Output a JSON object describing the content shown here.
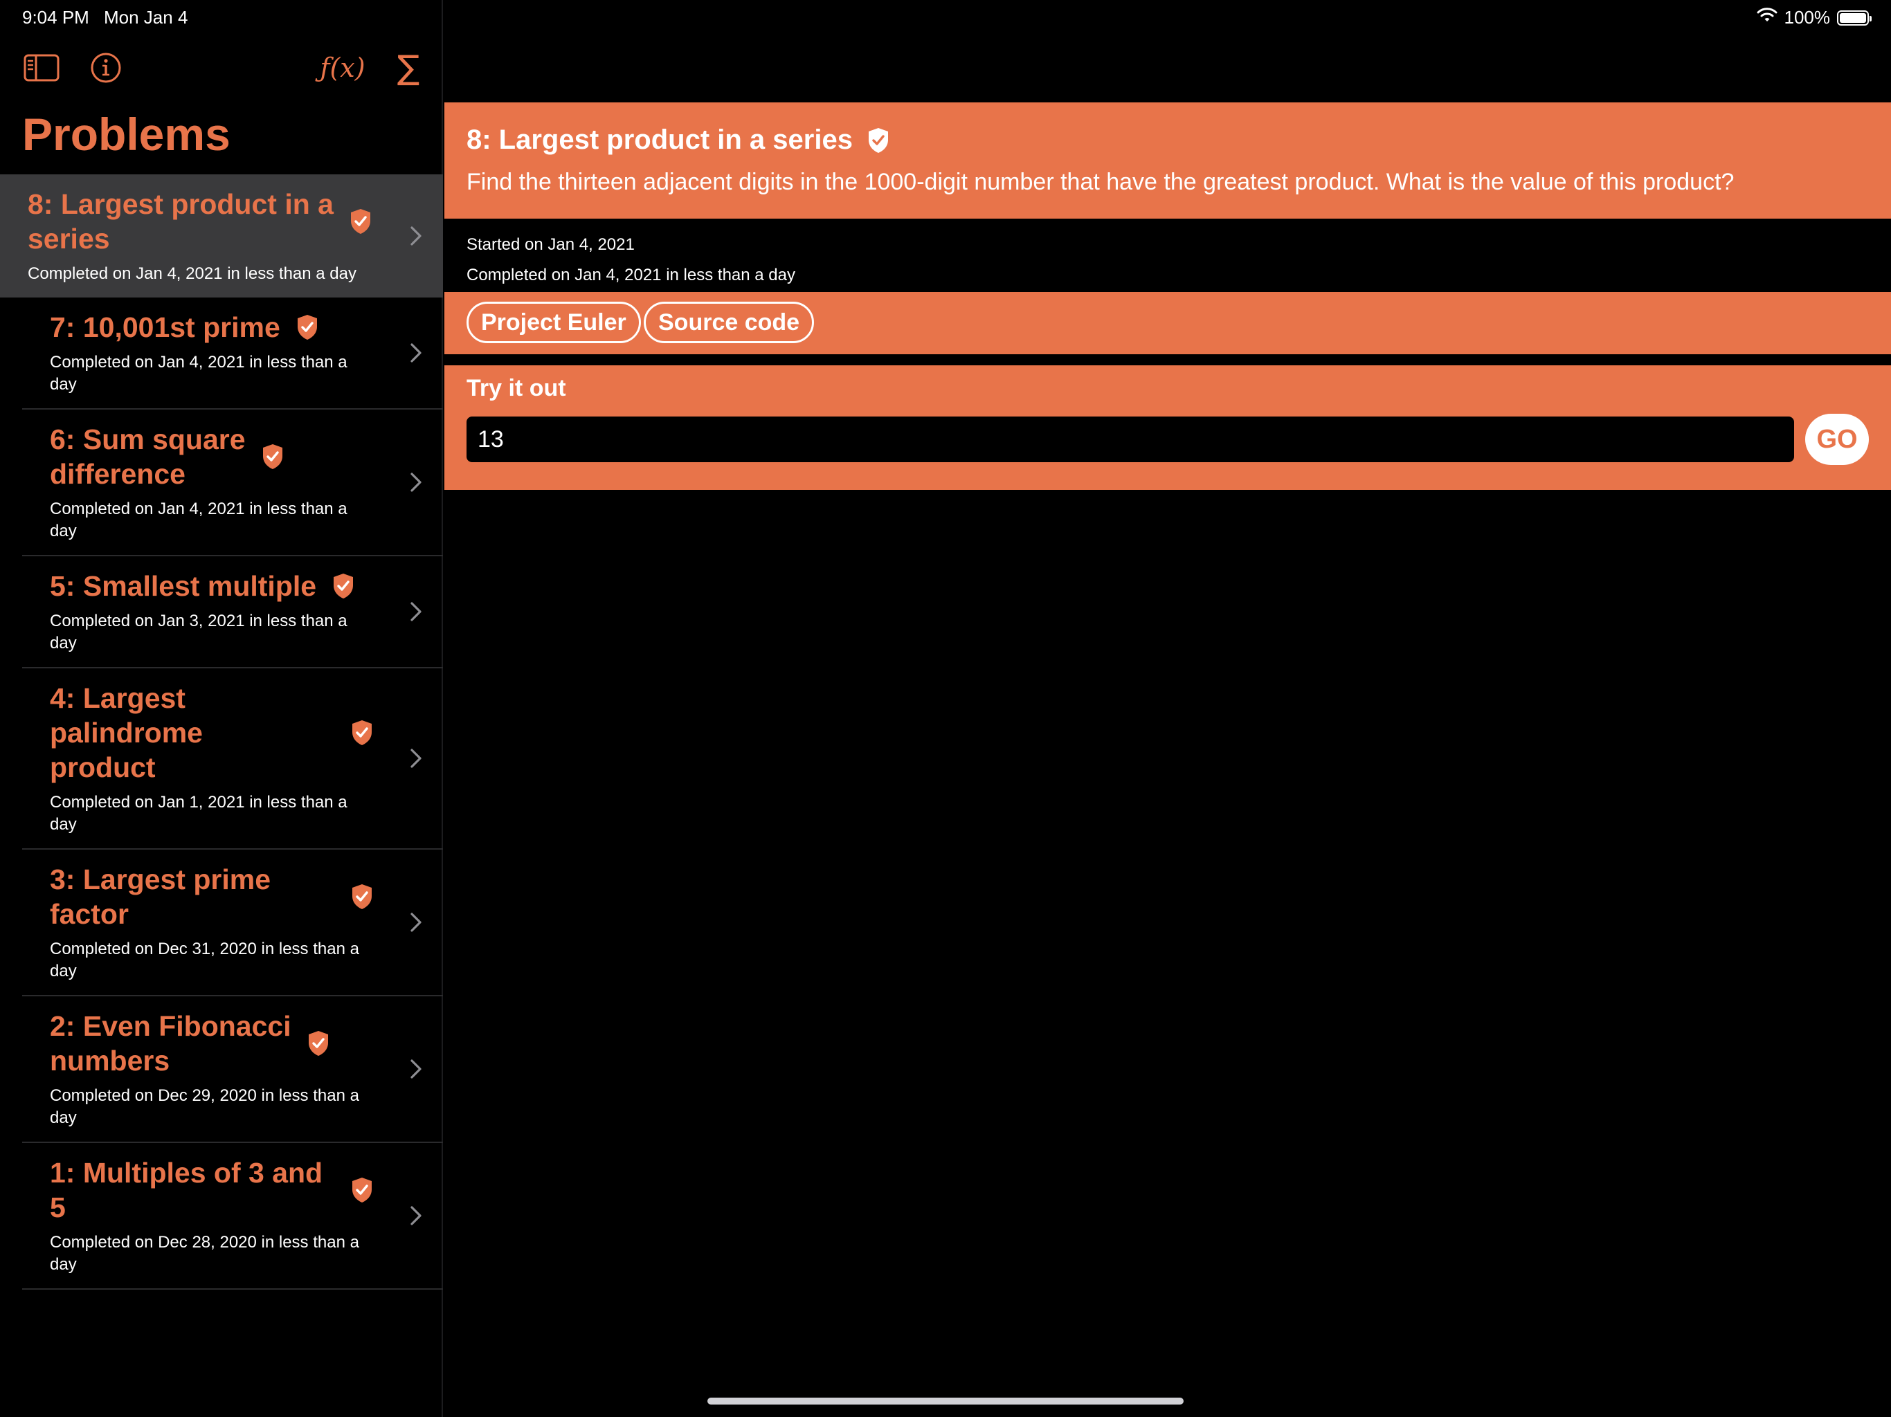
{
  "status_bar": {
    "time": "9:04 PM",
    "date": "Mon Jan 4",
    "battery_text": "100%",
    "battery_level": 1.0,
    "icons": [
      "wifi-icon",
      "battery-icon"
    ]
  },
  "sidebar": {
    "title": "Problems",
    "toolbar": {
      "sidebar_toggle_icon": "sidebar-toggle-icon",
      "info_icon": "info-icon",
      "function_label": "ƒ(x)",
      "sigma_label": "∑"
    },
    "problems": [
      {
        "title_lines": [
          "8: Largest product in a",
          "series"
        ],
        "subtitle": "Completed on Jan 4, 2021 in less than a day",
        "selected": true
      },
      {
        "title_lines": [
          "7: 10,001st prime"
        ],
        "subtitle": "Completed on Jan 4, 2021 in less than a day",
        "selected": false
      },
      {
        "title_lines": [
          "6: Sum square",
          "difference"
        ],
        "subtitle": "Completed on Jan 4, 2021 in less than a day",
        "selected": false
      },
      {
        "title_lines": [
          "5: Smallest multiple"
        ],
        "subtitle": "Completed on Jan 3, 2021 in less than a day",
        "selected": false
      },
      {
        "title_lines": [
          "4: Largest palindrome",
          "product"
        ],
        "subtitle": "Completed on Jan 1, 2021 in less than a day",
        "selected": false
      },
      {
        "title_lines": [
          "3: Largest prime factor"
        ],
        "subtitle_lines": [
          "Completed on Dec 31, 2020 in less than a",
          "day"
        ],
        "selected": false
      },
      {
        "title_lines": [
          "2: Even Fibonacci",
          "numbers"
        ],
        "subtitle_lines": [
          "Completed on Dec 29, 2020 in less than a",
          "day"
        ],
        "selected": false
      },
      {
        "title_lines": [
          "1: Multiples of 3 and 5"
        ],
        "subtitle_lines": [
          "Completed on Dec 28, 2020 in less than a",
          "day"
        ],
        "selected": false
      }
    ]
  },
  "detail": {
    "title": "8: Largest product in a series",
    "description": "Find the thirteen adjacent digits in the 1000-digit number that have the greatest product. What is the value of this product?",
    "started": "Started on Jan 4, 2021",
    "completed": "Completed on Jan 4, 2021 in less than a day",
    "links": {
      "project_euler": "Project Euler",
      "source_code": "Source code"
    },
    "try_it_out": {
      "label": "Try it out",
      "input_value": "13",
      "go_label": "GO"
    }
  },
  "colors": {
    "accent": "#E8744A",
    "background": "#000000",
    "selected_row": "#3a3a3c"
  }
}
